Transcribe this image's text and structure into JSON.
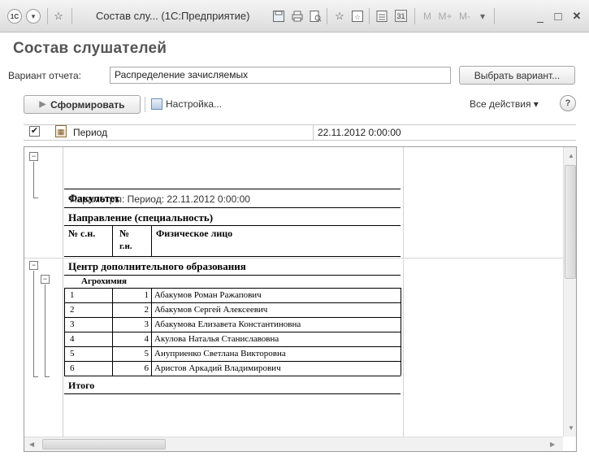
{
  "window": {
    "title": "Состав слу... (1С:Предприятие)",
    "logo_text": "1С",
    "menu_glyph": "▾",
    "star_glyph": "☆",
    "memory_buttons": [
      "M",
      "M+",
      "M-"
    ],
    "calendar_glyph": "31",
    "minimize_glyph": "_",
    "maximize_glyph": "□",
    "close_glyph": "✕"
  },
  "form": {
    "title": "Состав слушателей",
    "variant_label": "Вариант отчета:",
    "variant_value": "Распределение зачисляемых",
    "choose_variant_button": "Выбрать вариант...",
    "generate_button": "Сформировать",
    "settings_link": "Настройка...",
    "all_actions": "Все действия ▾",
    "help": "?"
  },
  "settings_row": {
    "checked": true,
    "check_glyph": "✔",
    "label": "Период",
    "value": "22.11.2012 0:00:00"
  },
  "report": {
    "parameters_text": "Параметры:    Период: 22.11.2012 0:00:00",
    "header_faculty": "Факультет",
    "header_direction": "Направление (специальность)",
    "col_sn": "№ с.н.",
    "col_gn_1": "№",
    "col_gn_2": "г.н.",
    "col_person": "Физическое лицо",
    "group_faculty": "Центр дополнительного образования",
    "group_direction": "Агрохимия",
    "rows": [
      {
        "sn": "1",
        "gn": "1",
        "name": "Абакумов Роман Ражапович"
      },
      {
        "sn": "2",
        "gn": "2",
        "name": "Абакумов Сергей Алексеевич"
      },
      {
        "sn": "3",
        "gn": "3",
        "name": "Абакумова Елизавета Константиновна"
      },
      {
        "sn": "4",
        "gn": "4",
        "name": "Акулова Наталья Станиславовна"
      },
      {
        "sn": "5",
        "gn": "5",
        "name": "Ануприенко Светлана Викторовна"
      },
      {
        "sn": "6",
        "gn": "6",
        "name": "Аристов Аркадий Владимирович"
      }
    ],
    "total": "Итого"
  }
}
